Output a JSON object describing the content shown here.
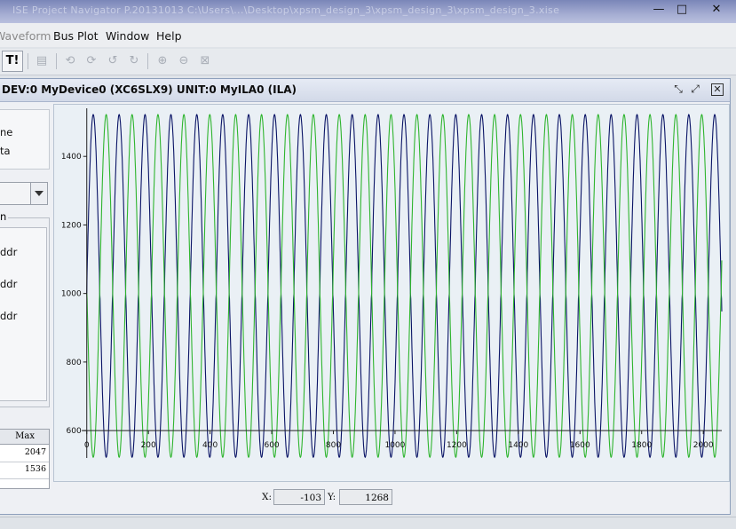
{
  "window": {
    "title": "ISE Project Navigator  P.20131013  C:\\Users\\...\\Desktop\\xpsm_design_3\\xpsm_design_3\\xpsm_design_3.xise",
    "controls": {
      "minimize": "—",
      "maximize": "□",
      "close": "✕"
    }
  },
  "menubar": {
    "items": [
      {
        "label": "Waveform",
        "dim": true
      },
      {
        "label": "Bus Plot",
        "dim": false
      },
      {
        "label": "Window",
        "dim": false
      },
      {
        "label": "Help",
        "dim": false
      }
    ]
  },
  "toolbar": {
    "trigger_label": "T!"
  },
  "frame": {
    "title": "DEV:0 MyDevice0 (XC6SLX9) UNIT:0 MyILA0 (ILA)"
  },
  "left_panel": {
    "top_lines": [
      "ne",
      "ta"
    ],
    "group_label": "n",
    "group_items": [
      "ddr",
      "ddr",
      "ddr"
    ],
    "table": {
      "header": "Max",
      "rows": [
        "2047",
        "1536"
      ]
    }
  },
  "coords": {
    "x_label": "X:",
    "x_value": "-103",
    "y_label": "Y:",
    "y_value": "1268"
  },
  "chart_data": {
    "type": "line",
    "title": "",
    "xlabel": "",
    "ylabel": "",
    "xlim": [
      -5,
      2060
    ],
    "ylim": [
      520,
      1530
    ],
    "x_ticks": [
      0,
      200,
      400,
      600,
      800,
      1000,
      1200,
      1400,
      1600,
      1800,
      2000
    ],
    "y_ticks": [
      600,
      800,
      1000,
      1200,
      1400
    ],
    "grid": false,
    "legend": "none",
    "series": [
      {
        "color": "#0a1466",
        "offset": 1022,
        "amplitude": 500,
        "clip_low": 1000,
        "clip_high": 1050,
        "period": 84,
        "phase": 0.0
      },
      {
        "color": "#2fb52f",
        "offset": 1022,
        "amplitude": 500,
        "clip_low": 1000,
        "clip_high": 1050,
        "period": 84,
        "phase": 3.14159
      }
    ]
  }
}
